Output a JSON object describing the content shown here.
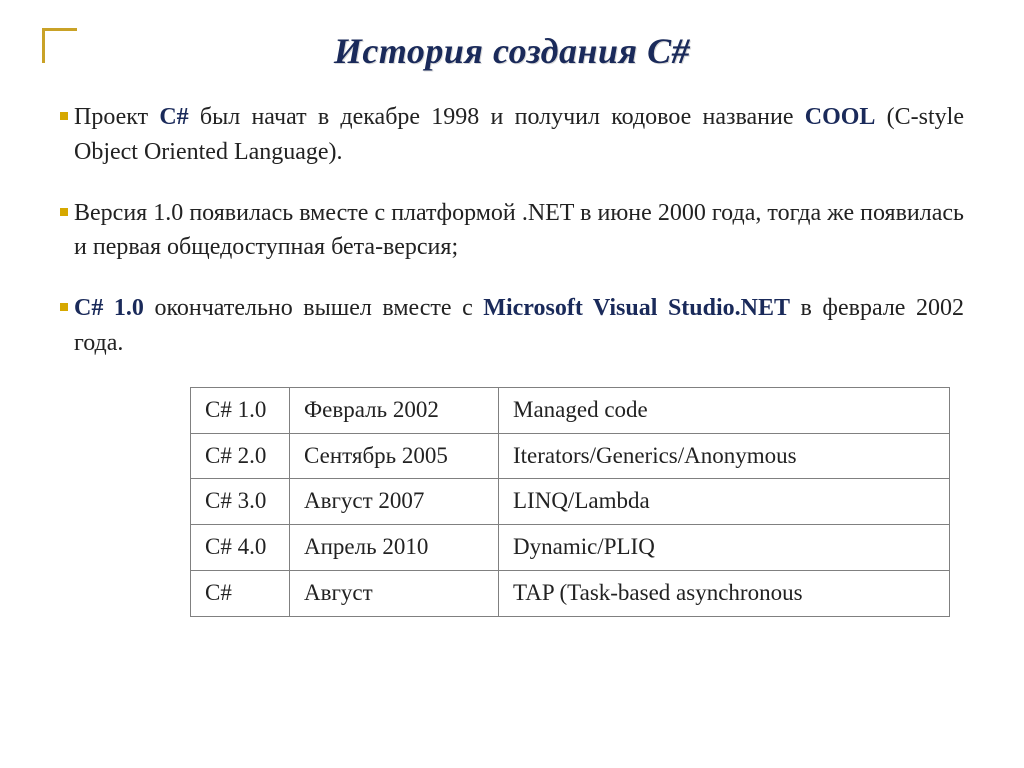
{
  "title": "История создания C#",
  "bullets": [
    {
      "pre": "Проект ",
      "em1": "C#",
      "mid": " был начат в декабре 1998 и получил кодовое название ",
      "em2": "COOL",
      "post": " (C-style Object Oriented Language)."
    },
    {
      "full": "Версия 1.0 появилась вместе с платформой .NET в июне 2000 года, тогда же появилась и первая общедоступная бета-версия;"
    },
    {
      "em1": "C# 1.0",
      "mid": " окончательно вышел вместе с ",
      "em2": "Microsoft Visual Studio.NET",
      "post": " в феврале 2002 года."
    }
  ],
  "table": [
    {
      "ver": "C# 1.0",
      "date": "Февраль 2002",
      "feature": "Managed code"
    },
    {
      "ver": "C# 2.0",
      "date": "Сентябрь 2005",
      "feature": "Iterators/Generics/Anonymous"
    },
    {
      "ver": "C# 3.0",
      "date": "Август 2007",
      "feature": "LINQ/Lambda"
    },
    {
      "ver": "C# 4.0",
      "date": "Апрель 2010",
      "feature": "Dynamic/PLIQ"
    },
    {
      "ver": "C#",
      "date": "Август",
      "feature": "TAP (Task-based asynchronous"
    }
  ]
}
